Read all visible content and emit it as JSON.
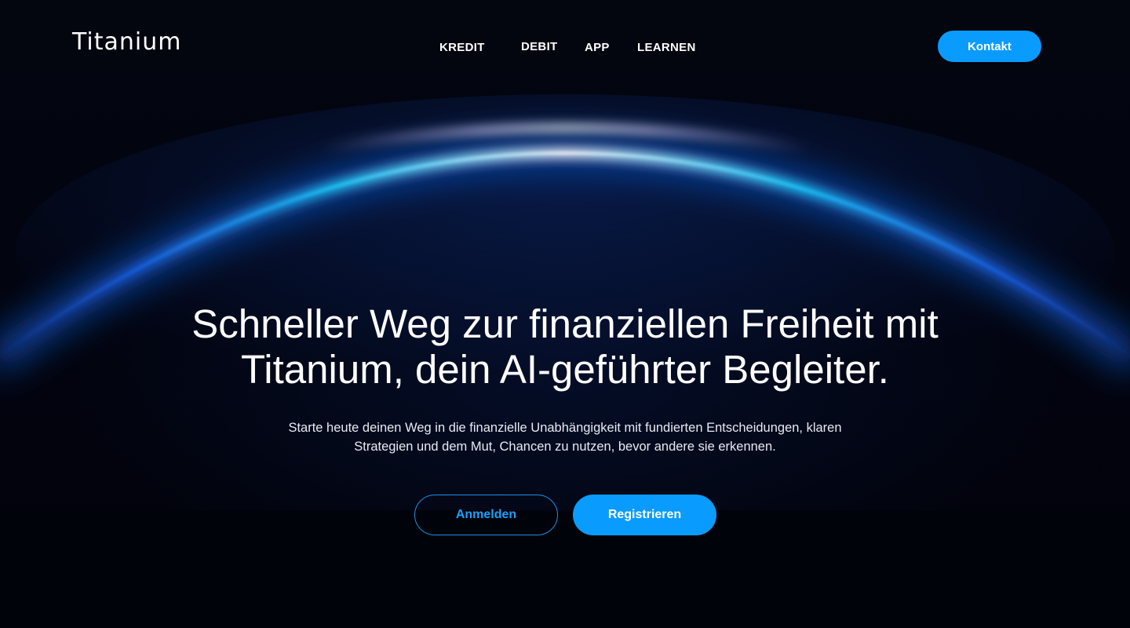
{
  "brand": {
    "name": "Titanium"
  },
  "nav": {
    "items": [
      {
        "label": "KREDIT"
      },
      {
        "label": "DEBIT"
      },
      {
        "label": "APP"
      },
      {
        "label": "LEARNEN"
      }
    ],
    "contact_label": "Kontakt"
  },
  "hero": {
    "title_line1": "Schneller Weg zur finanziellen Freiheit mit",
    "title_line2": "Titanium, dein AI-geführter Begleiter.",
    "subtitle_line1": "Starte heute deinen Weg in die finanzielle Unabhängigkeit mit fundierten Entscheidungen, klaren",
    "subtitle_line2": "Strategien und dem Mut, Chancen zu nutzen, bevor andere sie erkennen.",
    "login_label": "Anmelden",
    "register_label": "Registrieren"
  },
  "colors": {
    "background": "#02030c",
    "accent": "#0a9bff",
    "arc_glow": "#1fc8ff"
  }
}
